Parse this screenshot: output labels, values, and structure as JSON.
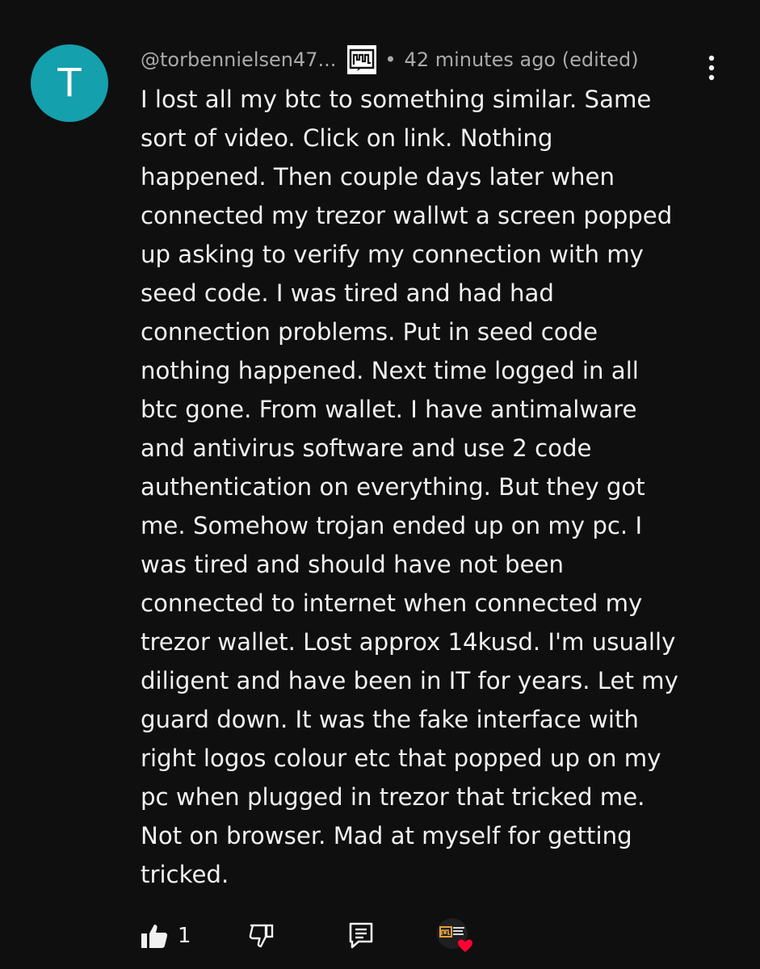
{
  "comment": {
    "avatar_letter": "T",
    "avatar_color": "#14a0ac",
    "author": "@torbennielsen47...",
    "separator": "•",
    "timestamp": "42 minutes ago (edited)",
    "body_lines": [
      "I lost all my btc to something similar. Same",
      "sort of video. Click on link. Nothing",
      "happened. Then couple days later when",
      "connected my trezor wallwt a screen popped",
      "up asking to verify my connection with my",
      "seed code. I was tired and had had",
      "connection problems. Put in seed code",
      "nothing happened. Next time logged in all",
      "btc gone. From wallet. I have antimalware",
      "and antivirus software and use 2 code",
      "authentication on everything. But they got",
      "me. Somehow trojan ended up on my pc. I",
      "was tired and should have not been",
      "connected to internet when connected my",
      "trezor wallet. Lost approx 14kusd. I'm usually",
      "diligent and have been in IT for years. Let my",
      "guard down. It was the fake interface with",
      "right logos colour etc that popped up on my",
      "pc when plugged in trezor that tricked me.",
      "Not on browser. Mad at myself for getting",
      "tricked."
    ],
    "like_count": "1",
    "creator_heart_text": "DIGITAL ASSET NEWS",
    "icons": {
      "like": "thumbs-up-icon",
      "dislike": "thumbs-down-icon",
      "reply": "reply-icon",
      "more": "more-vert-icon",
      "badge": "channel-badge-icon",
      "heart": "creator-heart-icon"
    },
    "colors": {
      "background": "#0f0f0f",
      "text": "#f1f1f1",
      "secondary_text": "#aaaaaa",
      "heart": "#ff0033"
    }
  }
}
